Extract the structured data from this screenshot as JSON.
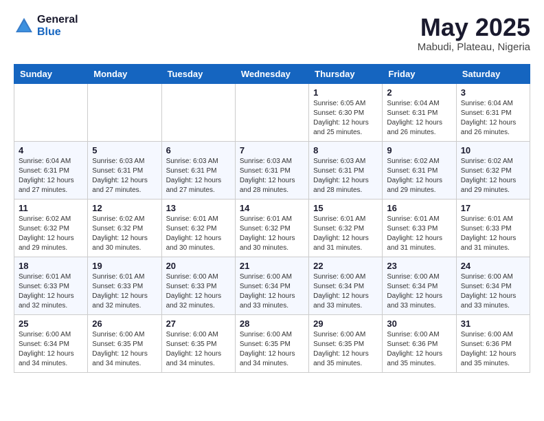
{
  "header": {
    "logo_general": "General",
    "logo_blue": "Blue",
    "month": "May 2025",
    "location": "Mabudi, Plateau, Nigeria"
  },
  "days_of_week": [
    "Sunday",
    "Monday",
    "Tuesday",
    "Wednesday",
    "Thursday",
    "Friday",
    "Saturday"
  ],
  "weeks": [
    [
      {
        "day": "",
        "info": ""
      },
      {
        "day": "",
        "info": ""
      },
      {
        "day": "",
        "info": ""
      },
      {
        "day": "",
        "info": ""
      },
      {
        "day": "1",
        "info": "Sunrise: 6:05 AM\nSunset: 6:30 PM\nDaylight: 12 hours and 25 minutes."
      },
      {
        "day": "2",
        "info": "Sunrise: 6:04 AM\nSunset: 6:31 PM\nDaylight: 12 hours and 26 minutes."
      },
      {
        "day": "3",
        "info": "Sunrise: 6:04 AM\nSunset: 6:31 PM\nDaylight: 12 hours and 26 minutes."
      }
    ],
    [
      {
        "day": "4",
        "info": "Sunrise: 6:04 AM\nSunset: 6:31 PM\nDaylight: 12 hours and 27 minutes."
      },
      {
        "day": "5",
        "info": "Sunrise: 6:03 AM\nSunset: 6:31 PM\nDaylight: 12 hours and 27 minutes."
      },
      {
        "day": "6",
        "info": "Sunrise: 6:03 AM\nSunset: 6:31 PM\nDaylight: 12 hours and 27 minutes."
      },
      {
        "day": "7",
        "info": "Sunrise: 6:03 AM\nSunset: 6:31 PM\nDaylight: 12 hours and 28 minutes."
      },
      {
        "day": "8",
        "info": "Sunrise: 6:03 AM\nSunset: 6:31 PM\nDaylight: 12 hours and 28 minutes."
      },
      {
        "day": "9",
        "info": "Sunrise: 6:02 AM\nSunset: 6:31 PM\nDaylight: 12 hours and 29 minutes."
      },
      {
        "day": "10",
        "info": "Sunrise: 6:02 AM\nSunset: 6:32 PM\nDaylight: 12 hours and 29 minutes."
      }
    ],
    [
      {
        "day": "11",
        "info": "Sunrise: 6:02 AM\nSunset: 6:32 PM\nDaylight: 12 hours and 29 minutes."
      },
      {
        "day": "12",
        "info": "Sunrise: 6:02 AM\nSunset: 6:32 PM\nDaylight: 12 hours and 30 minutes."
      },
      {
        "day": "13",
        "info": "Sunrise: 6:01 AM\nSunset: 6:32 PM\nDaylight: 12 hours and 30 minutes."
      },
      {
        "day": "14",
        "info": "Sunrise: 6:01 AM\nSunset: 6:32 PM\nDaylight: 12 hours and 30 minutes."
      },
      {
        "day": "15",
        "info": "Sunrise: 6:01 AM\nSunset: 6:32 PM\nDaylight: 12 hours and 31 minutes."
      },
      {
        "day": "16",
        "info": "Sunrise: 6:01 AM\nSunset: 6:33 PM\nDaylight: 12 hours and 31 minutes."
      },
      {
        "day": "17",
        "info": "Sunrise: 6:01 AM\nSunset: 6:33 PM\nDaylight: 12 hours and 31 minutes."
      }
    ],
    [
      {
        "day": "18",
        "info": "Sunrise: 6:01 AM\nSunset: 6:33 PM\nDaylight: 12 hours and 32 minutes."
      },
      {
        "day": "19",
        "info": "Sunrise: 6:01 AM\nSunset: 6:33 PM\nDaylight: 12 hours and 32 minutes."
      },
      {
        "day": "20",
        "info": "Sunrise: 6:00 AM\nSunset: 6:33 PM\nDaylight: 12 hours and 32 minutes."
      },
      {
        "day": "21",
        "info": "Sunrise: 6:00 AM\nSunset: 6:34 PM\nDaylight: 12 hours and 33 minutes."
      },
      {
        "day": "22",
        "info": "Sunrise: 6:00 AM\nSunset: 6:34 PM\nDaylight: 12 hours and 33 minutes."
      },
      {
        "day": "23",
        "info": "Sunrise: 6:00 AM\nSunset: 6:34 PM\nDaylight: 12 hours and 33 minutes."
      },
      {
        "day": "24",
        "info": "Sunrise: 6:00 AM\nSunset: 6:34 PM\nDaylight: 12 hours and 33 minutes."
      }
    ],
    [
      {
        "day": "25",
        "info": "Sunrise: 6:00 AM\nSunset: 6:34 PM\nDaylight: 12 hours and 34 minutes."
      },
      {
        "day": "26",
        "info": "Sunrise: 6:00 AM\nSunset: 6:35 PM\nDaylight: 12 hours and 34 minutes."
      },
      {
        "day": "27",
        "info": "Sunrise: 6:00 AM\nSunset: 6:35 PM\nDaylight: 12 hours and 34 minutes."
      },
      {
        "day": "28",
        "info": "Sunrise: 6:00 AM\nSunset: 6:35 PM\nDaylight: 12 hours and 34 minutes."
      },
      {
        "day": "29",
        "info": "Sunrise: 6:00 AM\nSunset: 6:35 PM\nDaylight: 12 hours and 35 minutes."
      },
      {
        "day": "30",
        "info": "Sunrise: 6:00 AM\nSunset: 6:36 PM\nDaylight: 12 hours and 35 minutes."
      },
      {
        "day": "31",
        "info": "Sunrise: 6:00 AM\nSunset: 6:36 PM\nDaylight: 12 hours and 35 minutes."
      }
    ]
  ]
}
